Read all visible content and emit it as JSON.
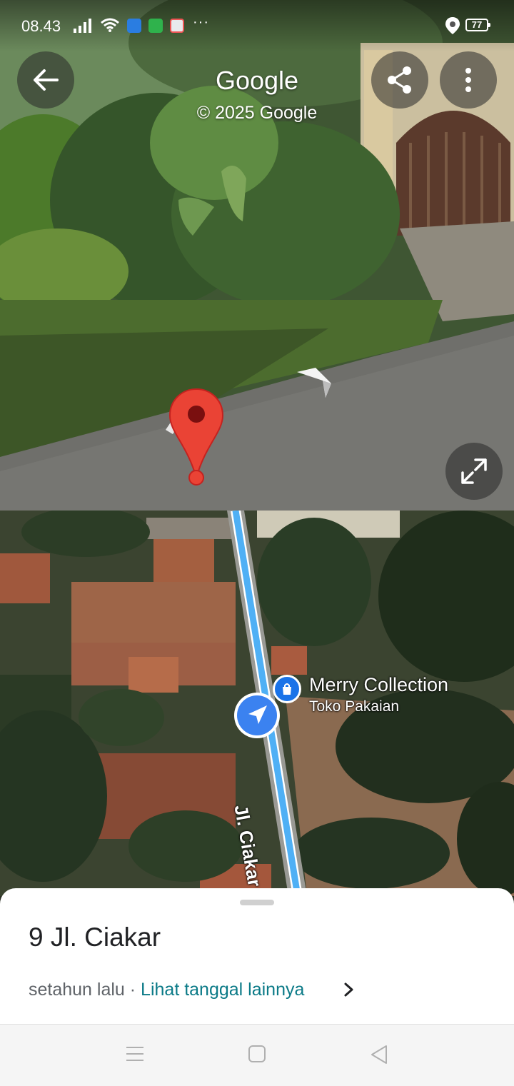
{
  "status_bar": {
    "time": "08.43",
    "more": "···",
    "battery": "77"
  },
  "street_view": {
    "title": "Google",
    "copyright": "© 2025 Google",
    "icons": [
      "back-arrow-icon",
      "share-icon",
      "more-vert-icon",
      "expand-icon",
      "location-pin-icon"
    ]
  },
  "map": {
    "road_label": "Jl. Ciakar",
    "poi_name": "Merry Collection",
    "poi_category": "Toko Pakaian",
    "poi_icon": "shopping-bag-icon",
    "route_color": "#4fb0f5"
  },
  "sheet": {
    "address": "9 Jl. Ciakar",
    "date_text": "setahun lalu · ",
    "date_link": "Lihat tanggal lainnya"
  },
  "nav_bar": {
    "icons": [
      "menu-icon",
      "home-icon",
      "back-icon"
    ]
  }
}
